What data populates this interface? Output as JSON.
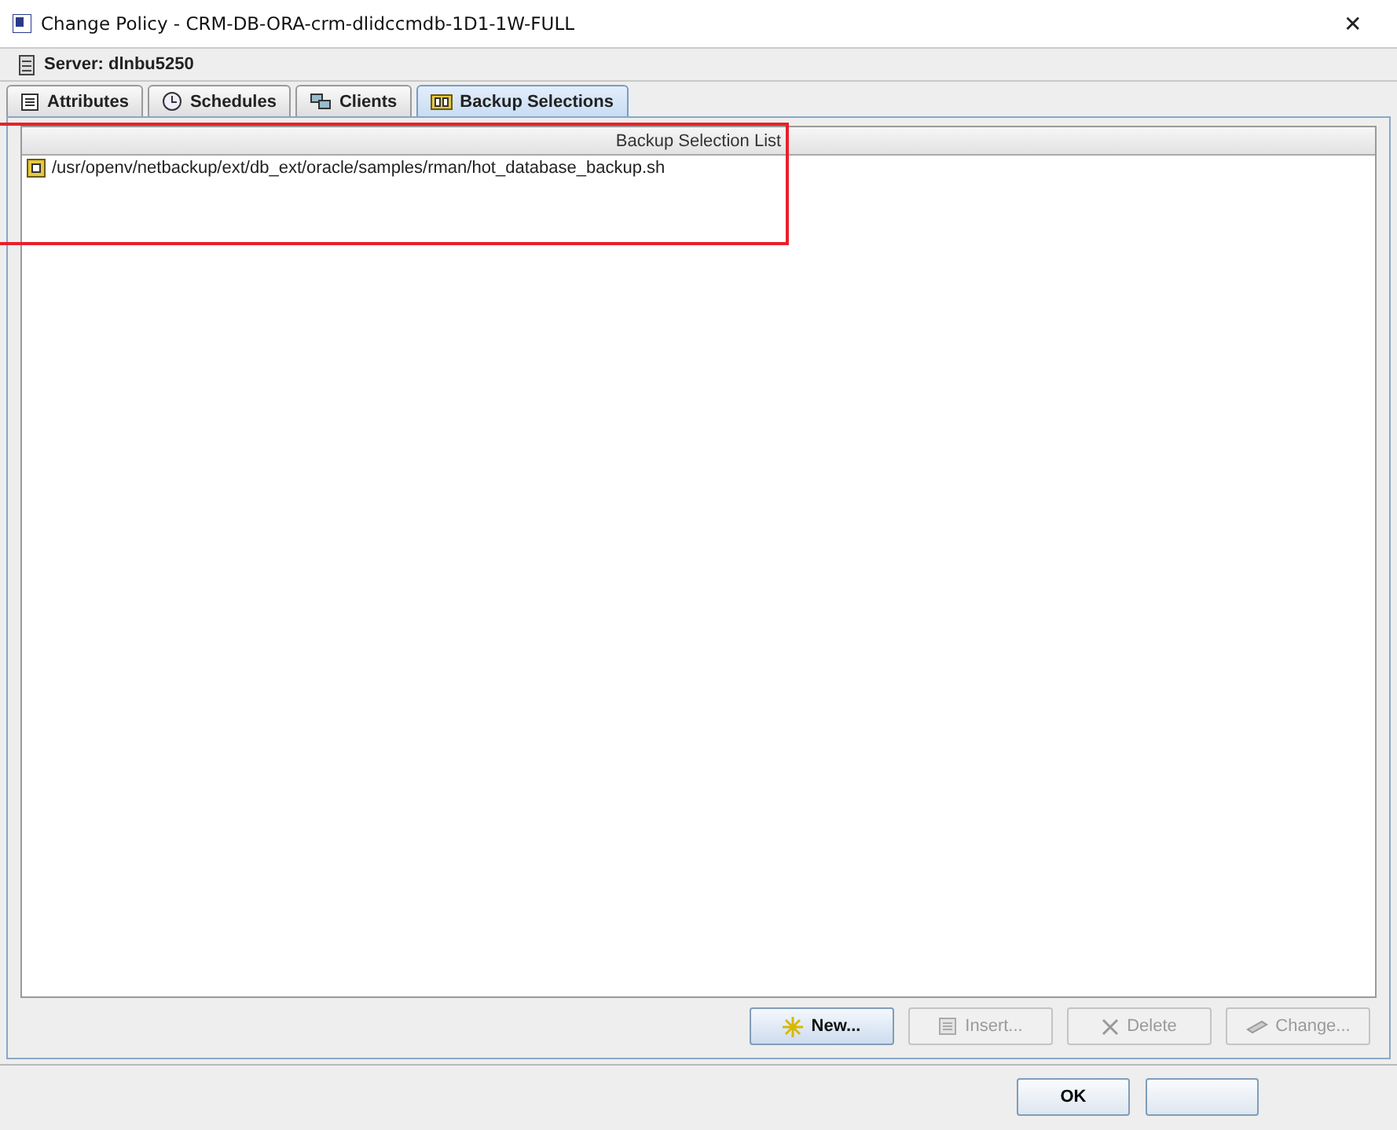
{
  "window": {
    "title": "Change Policy - CRM-DB-ORA-crm-dlidccmdb-1D1-1W-FULL",
    "close": "✕"
  },
  "server": "Server: dlnbu5250",
  "tabs": [
    {
      "label": "Attributes",
      "kind": "sheet",
      "selected": false
    },
    {
      "label": "Schedules",
      "kind": "clock",
      "selected": false
    },
    {
      "label": "Clients",
      "kind": "computers",
      "selected": false
    },
    {
      "label": "Backup Selections",
      "kind": "files",
      "selected": true
    }
  ],
  "list": {
    "header": "Backup Selection List",
    "rows": [
      "/usr/openv/netbackup/ext/db_ext/oracle/samples/rman/hot_database_backup.sh"
    ]
  },
  "actions": [
    {
      "label": "New...",
      "kind": "star",
      "disabled": false
    },
    {
      "label": "Insert...",
      "kind": "insert",
      "disabled": true
    },
    {
      "label": "Delete",
      "kind": "x",
      "disabled": true
    },
    {
      "label": "Change...",
      "kind": "change",
      "disabled": true
    }
  ],
  "footer": [
    "OK"
  ]
}
